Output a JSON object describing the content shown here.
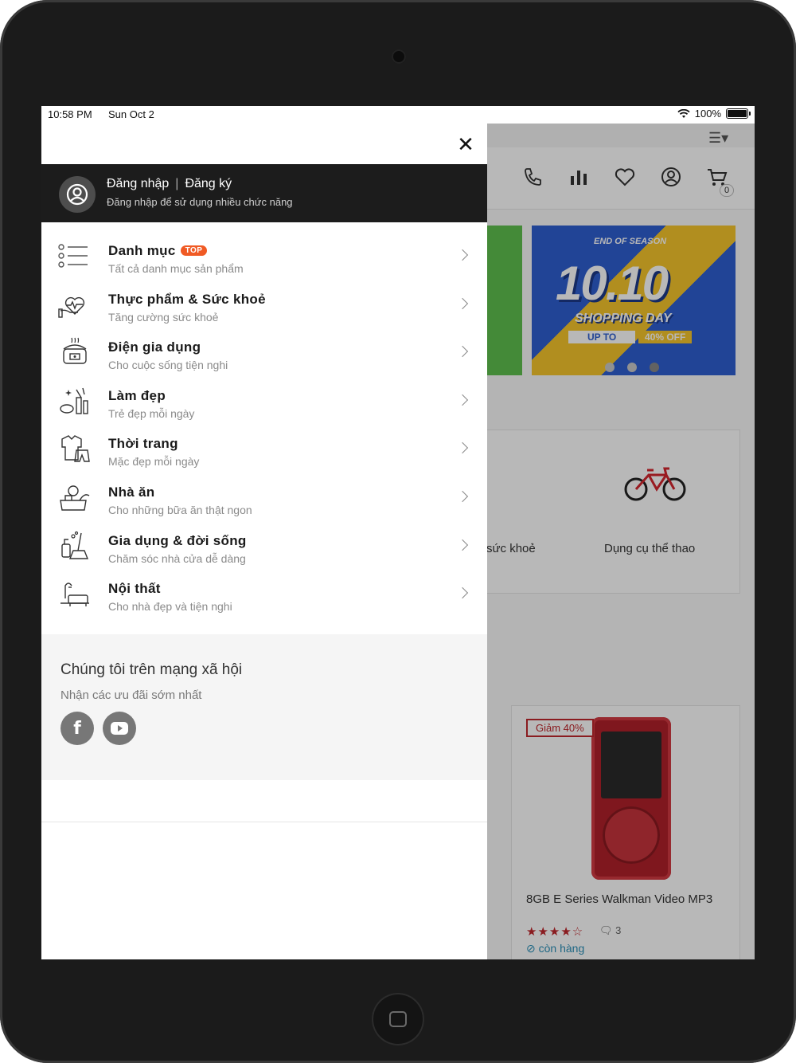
{
  "status_bar": {
    "time": "10:58 PM",
    "date": "Sun Oct 2",
    "battery": "100%"
  },
  "background": {
    "cart_count": "0",
    "banner": {
      "season": "END OF SEASON",
      "big": "10.10",
      "shopping": "SHOPPING DAY",
      "upto": "UP TO",
      "off": "40% OFF"
    },
    "categories": [
      "sức khoẻ",
      "Dụng cụ thể thao"
    ],
    "product": {
      "discount": "Giảm 40%",
      "name": "8GB E Series Walkman Video MP3",
      "stars": "★★★★☆",
      "reviews": "3",
      "stock": "còn hàng"
    }
  },
  "drawer": {
    "login": {
      "login": "Đăng nhập",
      "separator": "|",
      "register": "Đăng ký",
      "subtitle": "Đăng nhập để sử dụng nhiều chức năng"
    },
    "menu": [
      {
        "title": "Danh mục",
        "badge": "TOP",
        "subtitle": "Tất cả danh mục sản phẩm",
        "icon": "list-icon"
      },
      {
        "title": "Thực phẩm & Sức khoẻ",
        "subtitle": "Tăng cường sức khoẻ",
        "icon": "health-icon"
      },
      {
        "title": "Điện gia dụng",
        "subtitle": "Cho cuộc sống tiện nghi",
        "icon": "rice-cooker-icon"
      },
      {
        "title": "Làm đẹp",
        "subtitle": "Trẻ đẹp mỗi ngày",
        "icon": "cosmetics-icon"
      },
      {
        "title": "Thời trang",
        "subtitle": "Mặc đẹp mỗi ngày",
        "icon": "clothes-icon"
      },
      {
        "title": "Nhà ăn",
        "subtitle": "Cho những bữa ăn thật ngon",
        "icon": "kitchen-icon"
      },
      {
        "title": "Gia dụng & đời sống",
        "subtitle": "Chăm sóc nhà cửa dễ dàng",
        "icon": "cleaning-icon"
      },
      {
        "title": "Nội thất",
        "subtitle": "Cho nhà đẹp và tiện nghi",
        "icon": "furniture-icon"
      }
    ],
    "social": {
      "title": "Chúng tôi trên mạng xã hội",
      "subtitle": "Nhận các ưu đãi sớm nhất",
      "facebook": "f"
    }
  }
}
